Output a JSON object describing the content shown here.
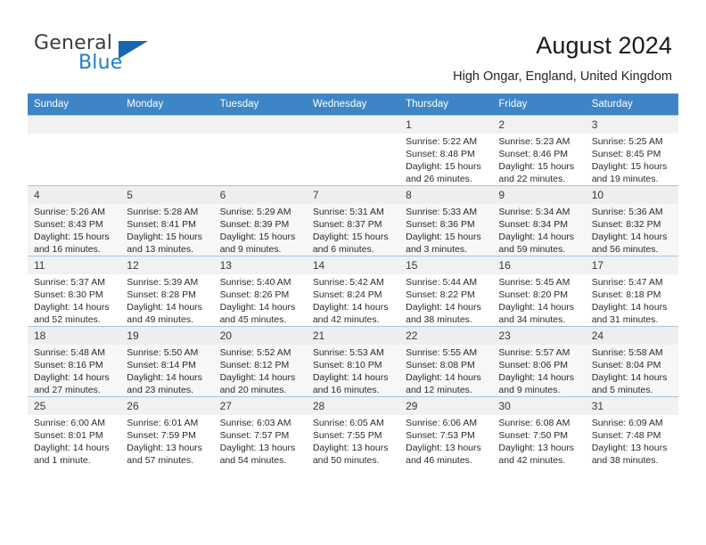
{
  "brand": {
    "name_part1": "General",
    "name_part2": "Blue",
    "triangle_color": "#1667b0",
    "blue_color": "#1f7fc4"
  },
  "header": {
    "title": "August 2024",
    "location": "High Ongar, England, United Kingdom"
  },
  "calendar": {
    "header_bg": "#3d85c6",
    "weekday_headers": [
      "Sunday",
      "Monday",
      "Tuesday",
      "Wednesday",
      "Thursday",
      "Friday",
      "Saturday"
    ],
    "weeks": [
      [
        {
          "day": "",
          "detail": ""
        },
        {
          "day": "",
          "detail": ""
        },
        {
          "day": "",
          "detail": ""
        },
        {
          "day": "",
          "detail": ""
        },
        {
          "day": "1",
          "detail": "Sunrise: 5:22 AM\nSunset: 8:48 PM\nDaylight: 15 hours\nand 26 minutes."
        },
        {
          "day": "2",
          "detail": "Sunrise: 5:23 AM\nSunset: 8:46 PM\nDaylight: 15 hours\nand 22 minutes."
        },
        {
          "day": "3",
          "detail": "Sunrise: 5:25 AM\nSunset: 8:45 PM\nDaylight: 15 hours\nand 19 minutes."
        }
      ],
      [
        {
          "day": "4",
          "detail": "Sunrise: 5:26 AM\nSunset: 8:43 PM\nDaylight: 15 hours\nand 16 minutes."
        },
        {
          "day": "5",
          "detail": "Sunrise: 5:28 AM\nSunset: 8:41 PM\nDaylight: 15 hours\nand 13 minutes."
        },
        {
          "day": "6",
          "detail": "Sunrise: 5:29 AM\nSunset: 8:39 PM\nDaylight: 15 hours\nand 9 minutes."
        },
        {
          "day": "7",
          "detail": "Sunrise: 5:31 AM\nSunset: 8:37 PM\nDaylight: 15 hours\nand 6 minutes."
        },
        {
          "day": "8",
          "detail": "Sunrise: 5:33 AM\nSunset: 8:36 PM\nDaylight: 15 hours\nand 3 minutes."
        },
        {
          "day": "9",
          "detail": "Sunrise: 5:34 AM\nSunset: 8:34 PM\nDaylight: 14 hours\nand 59 minutes."
        },
        {
          "day": "10",
          "detail": "Sunrise: 5:36 AM\nSunset: 8:32 PM\nDaylight: 14 hours\nand 56 minutes."
        }
      ],
      [
        {
          "day": "11",
          "detail": "Sunrise: 5:37 AM\nSunset: 8:30 PM\nDaylight: 14 hours\nand 52 minutes."
        },
        {
          "day": "12",
          "detail": "Sunrise: 5:39 AM\nSunset: 8:28 PM\nDaylight: 14 hours\nand 49 minutes."
        },
        {
          "day": "13",
          "detail": "Sunrise: 5:40 AM\nSunset: 8:26 PM\nDaylight: 14 hours\nand 45 minutes."
        },
        {
          "day": "14",
          "detail": "Sunrise: 5:42 AM\nSunset: 8:24 PM\nDaylight: 14 hours\nand 42 minutes."
        },
        {
          "day": "15",
          "detail": "Sunrise: 5:44 AM\nSunset: 8:22 PM\nDaylight: 14 hours\nand 38 minutes."
        },
        {
          "day": "16",
          "detail": "Sunrise: 5:45 AM\nSunset: 8:20 PM\nDaylight: 14 hours\nand 34 minutes."
        },
        {
          "day": "17",
          "detail": "Sunrise: 5:47 AM\nSunset: 8:18 PM\nDaylight: 14 hours\nand 31 minutes."
        }
      ],
      [
        {
          "day": "18",
          "detail": "Sunrise: 5:48 AM\nSunset: 8:16 PM\nDaylight: 14 hours\nand 27 minutes."
        },
        {
          "day": "19",
          "detail": "Sunrise: 5:50 AM\nSunset: 8:14 PM\nDaylight: 14 hours\nand 23 minutes."
        },
        {
          "day": "20",
          "detail": "Sunrise: 5:52 AM\nSunset: 8:12 PM\nDaylight: 14 hours\nand 20 minutes."
        },
        {
          "day": "21",
          "detail": "Sunrise: 5:53 AM\nSunset: 8:10 PM\nDaylight: 14 hours\nand 16 minutes."
        },
        {
          "day": "22",
          "detail": "Sunrise: 5:55 AM\nSunset: 8:08 PM\nDaylight: 14 hours\nand 12 minutes."
        },
        {
          "day": "23",
          "detail": "Sunrise: 5:57 AM\nSunset: 8:06 PM\nDaylight: 14 hours\nand 9 minutes."
        },
        {
          "day": "24",
          "detail": "Sunrise: 5:58 AM\nSunset: 8:04 PM\nDaylight: 14 hours\nand 5 minutes."
        }
      ],
      [
        {
          "day": "25",
          "detail": "Sunrise: 6:00 AM\nSunset: 8:01 PM\nDaylight: 14 hours\nand 1 minute."
        },
        {
          "day": "26",
          "detail": "Sunrise: 6:01 AM\nSunset: 7:59 PM\nDaylight: 13 hours\nand 57 minutes."
        },
        {
          "day": "27",
          "detail": "Sunrise: 6:03 AM\nSunset: 7:57 PM\nDaylight: 13 hours\nand 54 minutes."
        },
        {
          "day": "28",
          "detail": "Sunrise: 6:05 AM\nSunset: 7:55 PM\nDaylight: 13 hours\nand 50 minutes."
        },
        {
          "day": "29",
          "detail": "Sunrise: 6:06 AM\nSunset: 7:53 PM\nDaylight: 13 hours\nand 46 minutes."
        },
        {
          "day": "30",
          "detail": "Sunrise: 6:08 AM\nSunset: 7:50 PM\nDaylight: 13 hours\nand 42 minutes."
        },
        {
          "day": "31",
          "detail": "Sunrise: 6:09 AM\nSunset: 7:48 PM\nDaylight: 13 hours\nand 38 minutes."
        }
      ]
    ]
  }
}
